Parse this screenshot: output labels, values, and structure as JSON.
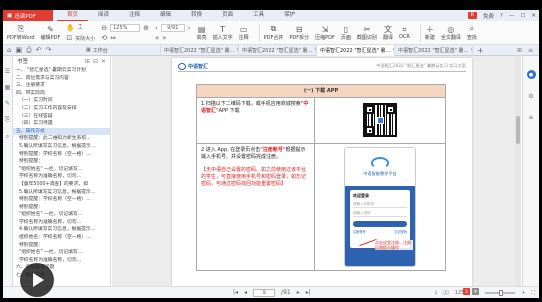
{
  "app": {
    "name": "迅读PDF",
    "menu_tabs": [
      "首页",
      "阅读",
      "注释",
      "编辑",
      "转换",
      "页面",
      "工具",
      "保护"
    ],
    "active_menu": "首页",
    "window": {
      "badge": "K",
      "user": "免费",
      "help": "?"
    }
  },
  "toolbar": {
    "pdf_to_word": "PDF转Word",
    "edit_pdf": "编辑PDF",
    "actual_size": "实际大小",
    "zoom_value": "125%",
    "page_value": "9",
    "page_total": "/91",
    "highlight": "高亮",
    "insert_text": "插入文字",
    "annotate": "注释",
    "pdf_merge": "PDF合并",
    "pdf_split": "PDF拆分",
    "compress_pdf": "压缩PDF",
    "page": "页面",
    "crop": "截图识别",
    "translate": "翻译",
    "ocr": "OCR",
    "new": "新建",
    "full_translate": "全文翻译",
    "find": "查找"
  },
  "tabs": {
    "workbench": "工作台",
    "items": [
      "中语智汇2022 \"智汇星选\" 暑...",
      "中语智汇2022 \"智汇星选\" 暑...",
      "中语智汇2022 \"智汇星选\" 暑...",
      "中语智汇2022 \"智汇星选\" 暑..."
    ],
    "active_index": 2
  },
  "outline": {
    "title": "书签",
    "items": [
      "一、 \"智汇星选\" 暑期云实习计划",
      "二、岗位需求与实习内容",
      "三、注册要求",
      "四、带实际岗",
      "（一）实习时间",
      "（二）实习工作内容及安排",
      "（三）在线答疑",
      "（四）实习待遇",
      "五、操作方式",
      "特别提醒：此二维码为新生系统...",
      "5.确认所填写实习信息，根据提示...",
      "特别提醒：学校名称（空一格）...",
      "特别提醒：",
      "\"组织姓名\" 一栏，切记填写...",
      "学校名称为准确名称，切勿...",
      "【童年5000+调查】的要求，如",
      "5.确认所填写实习信息，根据提示...",
      "特别提醒：学校名称（空一格）...",
      "特别提醒：",
      "\"组织姓名\" 一栏，切记填写...",
      "学校名称为准确名称，切勿...",
      "4.确认所填写实习信息，根据提示...",
      "组织姓名：学校名称（空一格）...",
      "特别提醒：",
      "\"组织姓名\" 一栏，切记填写...",
      "学校名称为准确名称，切勿...",
      "六、后续常见问题",
      "七、联系方式"
    ],
    "active_index": 8
  },
  "document": {
    "header_org": "中语智汇",
    "header_right": "中语智汇2022 \"智汇星选\" 暑期云实习 实习方案",
    "section_title": "(一) 下载 APP",
    "row1_text_prefix": "1.扫描以下二维码下载，或手机应用商城搜索",
    "row1_app_name": "\"中语智汇\"",
    "row1_text_suffix": "APP 下载",
    "row2_text_a": "2 进入 App, 在登录页点击",
    "row2_register": "\"注册账号\"",
    "row2_text_b": "根据提示输入手机号、并设置密码完成注册。",
    "row2_red_note": "【无中语自己设置的密码。如之前使用过该平台的学生，可直接使用手机号和密码登录，如忘记密码，可通过密码找回功能重置密码】",
    "phone_app_title": "中语智能教学平台",
    "phone_welcome": "欢迎登录",
    "phone_field_user": "请输入手机号",
    "phone_field_pass": "请输入密码",
    "phone_link_register": "注册账号",
    "phone_link_forgot": "忘记密码",
    "phone_note": "点击这里注册，注册后按提示操作"
  },
  "statusbar": {
    "page_current": "9",
    "page_total": "/91",
    "zoom": "125%"
  }
}
